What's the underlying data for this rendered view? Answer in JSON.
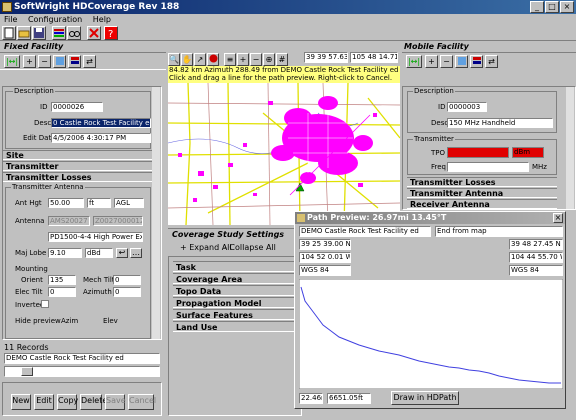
{
  "app": {
    "title": "SoftWright HDCoverage Rev 188"
  },
  "menu": [
    "File",
    "Configuration",
    "Help"
  ],
  "fixed": {
    "title": "Fixed Facility",
    "description_label": "Description",
    "id_label": "ID",
    "id": "0000026",
    "desc_label": "Desc",
    "desc": "0 Castle Rock Test Facility ed",
    "edit_label": "Edit Date",
    "edit_date": "4/5/2006 4:30:17 PM",
    "site": "Site",
    "transmitter": "Transmitter",
    "losses": "Transmitter Losses",
    "antenna": "Transmitter Antenna",
    "ant_hgt_label": "Ant Hgt",
    "ant_hgt": "50.00",
    "ant_hgt_unit": "ft",
    "ant_hgt_ref": "AGL",
    "antenna_label": "Antenna",
    "antenna_a": "AMS20027",
    "antenna_b": "Z0027000012",
    "antenna_model": "PD1500-4-4 High Power Expo",
    "maj_lobe_label": "Maj Lobe",
    "maj_lobe": "9.10",
    "maj_lobe_unit": "dBd",
    "mounting": "Mounting",
    "orient_label": "Orient",
    "orient": "135",
    "mech_tilt_label": "Mech Tilt",
    "mech_tilt": "0",
    "elec_tilt_label": "Elec Tilt",
    "elec_tilt": "0",
    "azimuth_label": "Azimuth",
    "azimuth": "0",
    "inverted": "Inverted",
    "hide_preview": "Hide preview",
    "azim": "Azim",
    "elev": "Elev"
  },
  "records": {
    "count": "11 Records",
    "selected": "DEMO Castle Rock Test Facility ed",
    "buttons": [
      "New",
      "Edit",
      "Copy",
      "Delete",
      "Save",
      "Cancel"
    ]
  },
  "map": {
    "lat": "39 39 57.63N",
    "lon": "105 48 14.71W",
    "info": "84.82 km Azimuth 288.49 from DEMO Castle Rock Test Facility ed",
    "instr": "Click and drag a line for the path preview.  Right-click to Cancel."
  },
  "coverage": {
    "title": "Coverage Study Settings",
    "expand": "+ Expand All",
    "collapse": "- Collapse All",
    "items": [
      "Task",
      "Coverage Area",
      "Topo Data",
      "Propagation Model",
      "Surface Features",
      "Land Use"
    ]
  },
  "mobile": {
    "title": "Mobile Facility",
    "description_label": "Description",
    "id_label": "ID",
    "id": "0000003",
    "desc_label": "Desc",
    "desc": "150 MHz Handheld",
    "transmitter": "Transmitter",
    "tpo_label": "TPO",
    "tpo_unit": "dBm",
    "freq_label": "Freq",
    "freq_unit": "MHz",
    "losses": "Transmitter Losses",
    "antenna": "Transmitter Antenna",
    "rx_antenna": "Receiver Antenna"
  },
  "path": {
    "title": "Path Preview: 26.97mi 13.45°T",
    "start_name": "DEMO Castle Rock Test Facility ed",
    "end_name": "End from map",
    "start_lat": "39 25 39.00 N",
    "start_lon": "104 52 0.01 W",
    "start_datum": "WGS 84",
    "end_lat": "39 48 27.45 N",
    "end_lon": "104 44 55.70 W",
    "end_datum": "WGS 84",
    "distance": "22.46mi",
    "elevation": "6651.05ft",
    "draw_btn": "Draw in HDPath"
  },
  "colors": {
    "title_start": "#0a246a",
    "title_end": "#3a6ea5",
    "coverage": "#ff00ff",
    "roads": "#e0e000",
    "profile": "#4040e0"
  }
}
